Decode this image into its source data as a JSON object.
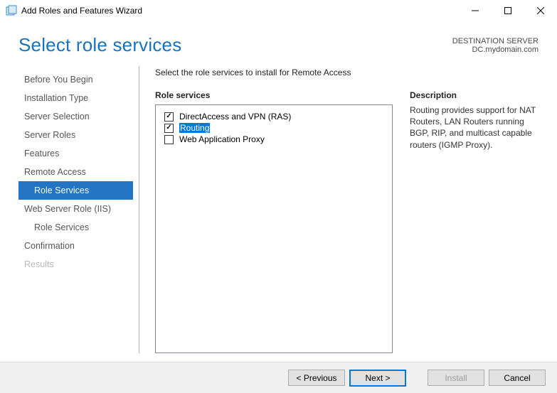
{
  "window": {
    "title": "Add Roles and Features Wizard"
  },
  "page": {
    "title": "Select role services",
    "destination_label": "DESTINATION SERVER",
    "destination_server": "DC.mydomain.com",
    "instruction": "Select the role services to install for Remote Access"
  },
  "sidebar": {
    "steps": [
      {
        "label": "Before You Begin",
        "sub": false,
        "active": false,
        "disabled": false
      },
      {
        "label": "Installation Type",
        "sub": false,
        "active": false,
        "disabled": false
      },
      {
        "label": "Server Selection",
        "sub": false,
        "active": false,
        "disabled": false
      },
      {
        "label": "Server Roles",
        "sub": false,
        "active": false,
        "disabled": false
      },
      {
        "label": "Features",
        "sub": false,
        "active": false,
        "disabled": false
      },
      {
        "label": "Remote Access",
        "sub": false,
        "active": false,
        "disabled": false
      },
      {
        "label": "Role Services",
        "sub": true,
        "active": true,
        "disabled": false
      },
      {
        "label": "Web Server Role (IIS)",
        "sub": false,
        "active": false,
        "disabled": false
      },
      {
        "label": "Role Services",
        "sub": true,
        "active": false,
        "disabled": false
      },
      {
        "label": "Confirmation",
        "sub": false,
        "active": false,
        "disabled": false
      },
      {
        "label": "Results",
        "sub": false,
        "active": false,
        "disabled": true
      }
    ]
  },
  "roleservices": {
    "heading": "Role services",
    "items": [
      {
        "label": "DirectAccess and VPN (RAS)",
        "checked": true,
        "selected": false
      },
      {
        "label": "Routing",
        "checked": true,
        "selected": true
      },
      {
        "label": "Web Application Proxy",
        "checked": false,
        "selected": false
      }
    ]
  },
  "description": {
    "heading": "Description",
    "text": "Routing provides support for NAT Routers, LAN Routers running BGP, RIP, and multicast capable routers (IGMP Proxy)."
  },
  "footer": {
    "previous": "< Previous",
    "next": "Next >",
    "install": "Install",
    "cancel": "Cancel"
  }
}
